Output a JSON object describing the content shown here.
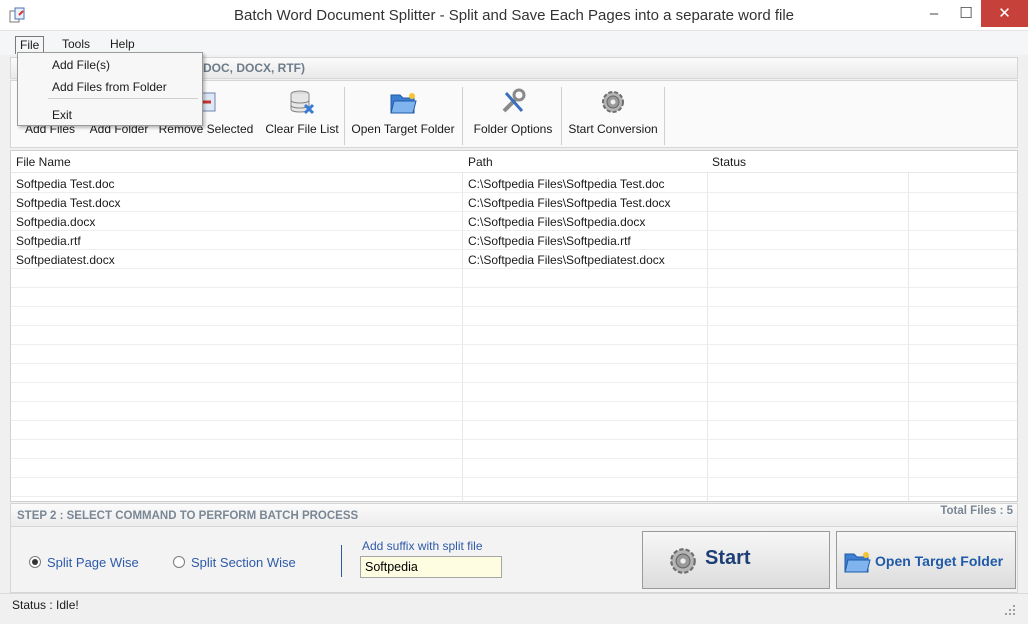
{
  "window": {
    "title": "Batch Word Document Splitter - Split and Save Each Pages into a separate word file",
    "minimize": "–",
    "maximize": "☐",
    "close": "✕"
  },
  "menu": [
    "File",
    "Tools",
    "Help"
  ],
  "file_menu": {
    "items": [
      "Add File(s)",
      "Add Files from Folder",
      "Exit"
    ]
  },
  "step1": {
    "visible_text": "DOC, DOCX, RTF)"
  },
  "toolbar": {
    "buttons": [
      {
        "label": "Add Files",
        "icon": "add-files-icon"
      },
      {
        "label": "Add Folder",
        "icon": "add-folder-icon"
      },
      {
        "label": "Remove Selected",
        "icon": "remove-selected-icon"
      },
      {
        "label": "Clear File List",
        "icon": "database-clear-icon"
      },
      {
        "label": "Open Target Folder",
        "icon": "open-folder-icon"
      },
      {
        "label": "Folder Options",
        "icon": "tools-icon"
      },
      {
        "label": "Start Conversion",
        "icon": "gear-icon"
      }
    ]
  },
  "table": {
    "columns": [
      "File Name",
      "Path",
      "Status"
    ],
    "rows": [
      {
        "file": "Softpedia Test.doc",
        "path": "C:\\Softpedia Files\\Softpedia Test.doc",
        "status": ""
      },
      {
        "file": "Softpedia Test.docx",
        "path": "C:\\Softpedia Files\\Softpedia Test.docx",
        "status": ""
      },
      {
        "file": "Softpedia.docx",
        "path": "C:\\Softpedia Files\\Softpedia.docx",
        "status": ""
      },
      {
        "file": "Softpedia.rtf",
        "path": "C:\\Softpedia Files\\Softpedia.rtf",
        "status": ""
      },
      {
        "file": "Softpediatest.docx",
        "path": "C:\\Softpedia Files\\Softpediatest.docx",
        "status": ""
      }
    ]
  },
  "step2": {
    "label": "STEP 2 : SELECT COMMAND TO PERFORM BATCH PROCESS",
    "total_files": "Total Files : 5"
  },
  "options": {
    "split_page_wise": "Split Page Wise",
    "split_section_wise": "Split Section Wise",
    "selected": "split_page_wise",
    "suffix_label": "Add suffix with split file",
    "suffix_value": "Softpedia"
  },
  "buttons": {
    "start": "Start",
    "open_target": "Open Target Folder"
  },
  "status": {
    "text": "Status  :  Idle!"
  },
  "colors": {
    "accent": "#2e5aa8",
    "close_button": "#c7413b",
    "suffix_bg": "#fffde1"
  }
}
